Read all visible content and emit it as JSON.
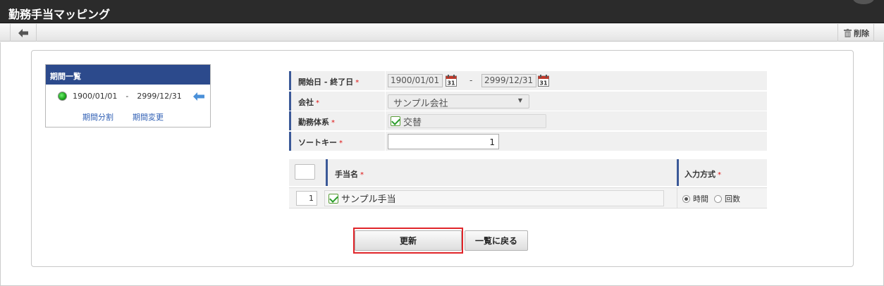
{
  "header": {
    "title": "勤務手当マッピング"
  },
  "toolbar": {
    "delete_label": "削除",
    "back_icon": "arrow-left-icon",
    "delete_icon": "trash-icon"
  },
  "period_list": {
    "title": "期間一覧",
    "start": "1900/01/01",
    "separator": "-",
    "end": "2999/12/31",
    "split_link": "期間分割",
    "change_link": "期間変更",
    "status_color": "#22aa22"
  },
  "form": {
    "date_range": {
      "label": "開始日 - 終了日",
      "start_value": "1900/01/01",
      "separator": "-",
      "end_value": "2999/12/31",
      "calendar_day": "31"
    },
    "company": {
      "label": "会社",
      "value": "サンプル会社"
    },
    "work_system": {
      "label": "勤務体系",
      "value": "交替",
      "checked": true
    },
    "sort_key": {
      "label": "ソートキー",
      "value": "1"
    },
    "required_mark": "*"
  },
  "allowance_table": {
    "columns": {
      "name": "手当名",
      "method": "入力方式"
    },
    "rows": [
      {
        "no": "1",
        "name": "サンプル手当",
        "checked": true,
        "options": [
          "時間",
          "回数"
        ],
        "selected": "時間"
      }
    ]
  },
  "actions": {
    "update_label": "更新",
    "back_list_label": "一覧に戻る",
    "highlight_color": "#e0252a"
  }
}
